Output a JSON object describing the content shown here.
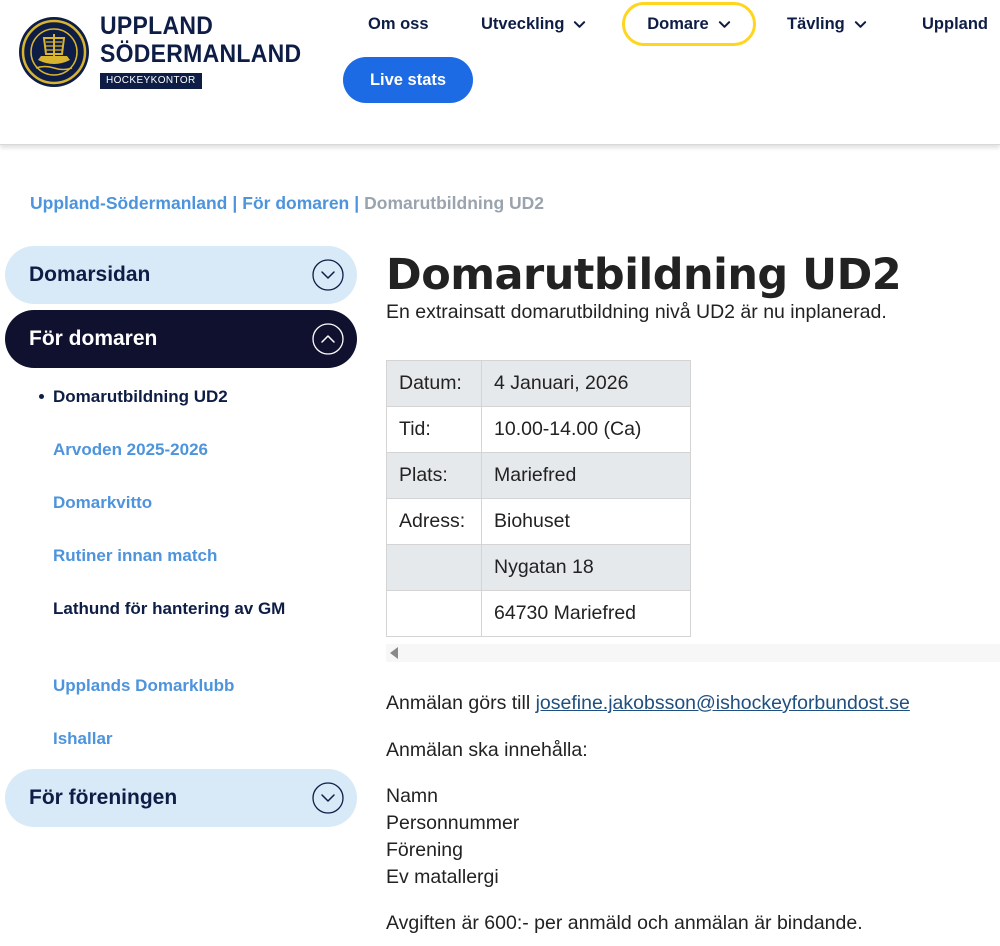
{
  "header": {
    "logo": {
      "line1": "UPPLAND",
      "line2": "SÖDERMANLAND",
      "sub": "HOCKEYKONTOR",
      "badge_icon": "viking-ship-emblem-icon"
    },
    "nav": [
      {
        "label": "Om oss",
        "dropdown": false
      },
      {
        "label": "Utveckling",
        "dropdown": true
      },
      {
        "label": "Domare",
        "dropdown": true,
        "active": true
      },
      {
        "label": "Tävling",
        "dropdown": true
      },
      {
        "label": "Uppland",
        "dropdown": false
      }
    ],
    "live_button": "Live stats"
  },
  "breadcrumb": {
    "items": [
      "Uppland-Södermanland",
      "För domaren"
    ],
    "separator": "|",
    "current": "Domarutbildning UD2"
  },
  "sidebar": {
    "sections": [
      {
        "label": "Domarsidan",
        "expanded": false,
        "icon": "chevron-down-circle-icon"
      },
      {
        "label": "För domaren",
        "expanded": true,
        "icon": "chevron-up-circle-icon"
      },
      {
        "label": "För föreningen",
        "expanded": false,
        "icon": "chevron-down-circle-icon"
      }
    ],
    "sub_items": [
      {
        "label": "Domarutbildning UD2",
        "active": true
      },
      {
        "label": "Arvoden 2025-2026"
      },
      {
        "label": "Domarkvitto"
      },
      {
        "label": "Rutiner innan match"
      },
      {
        "label": "Lathund för hantering av GM",
        "dark": true
      },
      {
        "label": "Upplands Domarklubb"
      },
      {
        "label": "Ishallar"
      }
    ]
  },
  "main": {
    "title": "Domarutbildning UD2",
    "intro": "En extrainsatt domarutbildning nivå UD2 är nu inplanerad.",
    "table": [
      [
        "Datum:",
        "4 Januari, 2026"
      ],
      [
        "Tid:",
        "10.00-14.00 (Ca)"
      ],
      [
        "Plats:",
        "Mariefred"
      ],
      [
        "Adress:",
        "Biohuset"
      ],
      [
        "",
        "Nygatan 18"
      ],
      [
        "",
        "64730 Mariefred"
      ]
    ],
    "signup_prefix": "Anmälan görs till ",
    "signup_email": "josefine.jakobsson@ishockeyforbundost.se",
    "content_heading": "Anmälan ska innehålla:",
    "content_list": [
      "Namn",
      "Personnummer",
      "Förening",
      "Ev matallergi"
    ],
    "fee_text": "Avgiften är 600:- per anmäld och anmälan är bindande."
  },
  "colors": {
    "navy": "#0e1d45",
    "link_blue": "#4d94dc",
    "button_blue": "#1d6ae5",
    "active_outline": "#ffd51d",
    "pill_light": "#d8eaf8",
    "pill_dark": "#10102f"
  }
}
